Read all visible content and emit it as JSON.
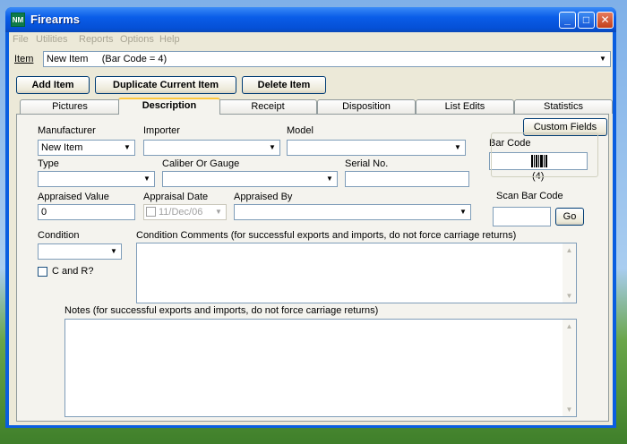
{
  "window": {
    "title": "Firearms",
    "icon_text": "NM"
  },
  "menu": [
    "File",
    "Utilities",
    "Reports",
    "Options",
    "Help"
  ],
  "item": {
    "label": "Item",
    "value": "New Item     (Bar Code = 4)"
  },
  "buttons": {
    "add": "Add Item",
    "duplicate": "Duplicate Current Item",
    "delete": "Delete Item",
    "custom_fields": "Custom Fields",
    "go": "Go"
  },
  "tabs": [
    "Pictures",
    "Description",
    "Receipt",
    "Disposition",
    "List Edits",
    "Statistics"
  ],
  "active_tab": "Description",
  "form": {
    "manufacturer": {
      "label": "Manufacturer",
      "value": "New Item"
    },
    "importer": {
      "label": "Importer",
      "value": ""
    },
    "model": {
      "label": "Model",
      "value": ""
    },
    "type": {
      "label": "Type",
      "value": ""
    },
    "caliber": {
      "label": "Caliber Or Gauge",
      "value": ""
    },
    "serial": {
      "label": "Serial No.",
      "value": ""
    },
    "appraised_value": {
      "label": "Appraised Value",
      "value": "0"
    },
    "appraisal_date": {
      "label": "Appraisal Date",
      "value": "11/Dec/06"
    },
    "appraised_by": {
      "label": "Appraised By",
      "value": ""
    },
    "condition": {
      "label": "Condition",
      "value": ""
    },
    "c_and_r": {
      "label": "C and R?",
      "checked": false
    },
    "condition_comments": {
      "label": "Condition Comments (for successful exports and imports, do not force carriage returns)",
      "value": ""
    },
    "notes": {
      "label": "Notes (for successful exports and imports, do not force carriage returns)",
      "value": ""
    },
    "bar_code": {
      "label": "Bar Code",
      "number": "(4)"
    },
    "scan_bar_code": {
      "label": "Scan Bar Code",
      "value": ""
    }
  },
  "colors": {
    "titlebar": "#0a5de8",
    "client_bg": "#ece9d8",
    "panel_bg": "#f4f3ee",
    "active_tab_accent": "#ffc83c",
    "close_button": "#c3401c"
  }
}
